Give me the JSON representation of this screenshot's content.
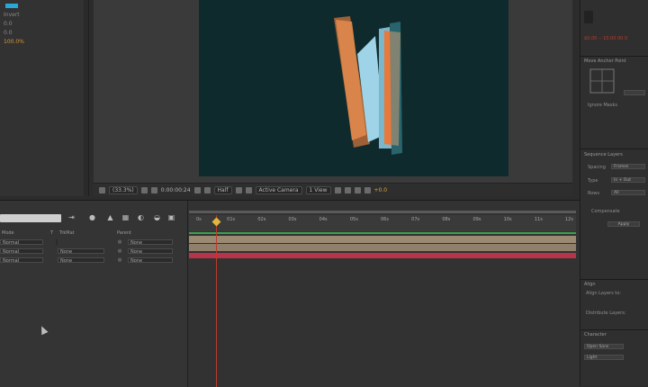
{
  "effects_panel": {
    "items": [
      "Invert",
      "0.0",
      "0.0",
      "100.0%"
    ],
    "accent_color": "#2aa6d8"
  },
  "viewer": {
    "zoom": "(33.3%)",
    "timecode": "0:00:00:24",
    "resolution": "Half",
    "camera": "Active Camera",
    "views": "1 View",
    "exposure": "+0.0",
    "canvas_color": "#0f2a2c"
  },
  "right_panels": {
    "info_value": "$0.00 -- 10.00 00.0",
    "motion_sketch": "Move Anchor Point",
    "ignore_masks": "Ignore Masks",
    "sequence_title": "Sequence Layers",
    "spacing_label": "Spacing",
    "spacing_value": "Frames",
    "type_label": "Type",
    "type_value": "In + Out",
    "rows_label": "Rows",
    "rows_value": "All",
    "compensate": "Compensate",
    "apply": "Apply",
    "align_title": "Align",
    "align_layers_to": "Align Layers to:",
    "distribute": "Distribute Layers:",
    "character_title": "Character",
    "font_name": "Open Sans",
    "font_style": "Light"
  },
  "timeline": {
    "columns": {
      "mode": "Mode",
      "t": "T",
      "trkmat": "TrkMat",
      "parent": "Parent"
    },
    "layers": [
      {
        "mode": "Normal",
        "trkmat": "",
        "parent": "None"
      },
      {
        "mode": "Normal",
        "trkmat": "None",
        "parent": "None"
      },
      {
        "mode": "Normal",
        "trkmat": "None",
        "parent": "None"
      }
    ],
    "ruler_ticks": [
      "0s",
      "01s",
      "02s",
      "03s",
      "04s",
      "05s",
      "06s",
      "07s",
      "08s",
      "09s",
      "10s",
      "11s",
      "12s"
    ],
    "bar_colors": [
      "#9a8a72",
      "#8f806c",
      "#b8344a"
    ]
  }
}
